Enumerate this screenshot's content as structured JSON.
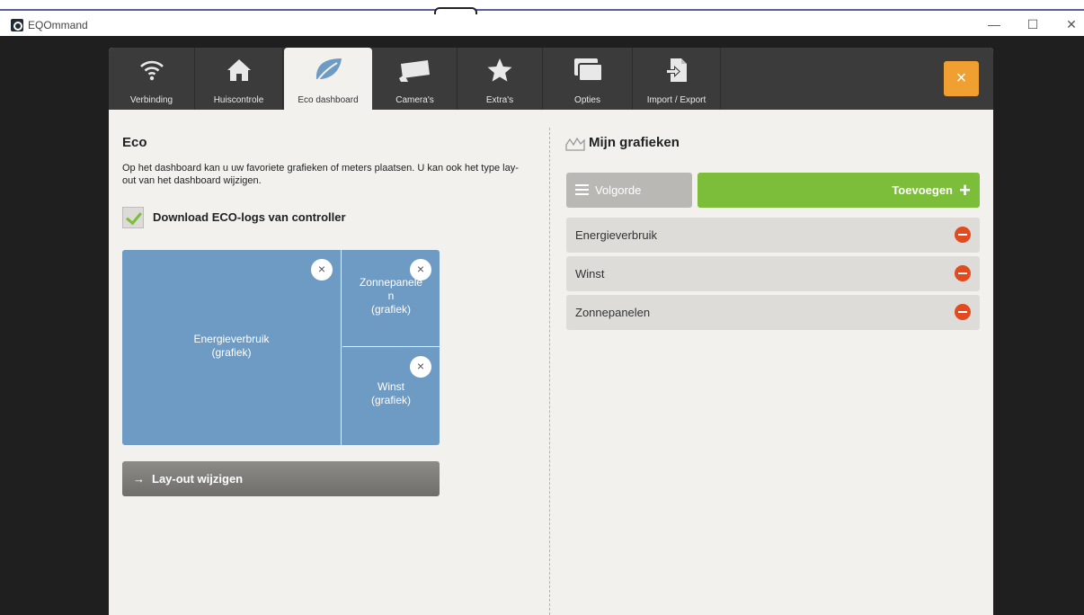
{
  "window": {
    "title": "EQOmmand",
    "minimize": "—",
    "maximize": "☐",
    "close": "✕"
  },
  "tabs": [
    {
      "label": "Verbinding",
      "icon": "wifi-icon"
    },
    {
      "label": "Huiscontrole",
      "icon": "house-icon"
    },
    {
      "label": "Eco dashboard",
      "icon": "leaf-icon",
      "active": true
    },
    {
      "label": "Camera's",
      "icon": "camera-icon"
    },
    {
      "label": "Extra's",
      "icon": "star-icon"
    },
    {
      "label": "Opties",
      "icon": "windows-icon"
    },
    {
      "label": "Import / Export",
      "icon": "import-export-icon"
    }
  ],
  "close_button": "×",
  "eco": {
    "title": "Eco",
    "description": "Op het dashboard kan u uw favoriete grafieken of meters plaatsen. U kan ook het type lay-out van het dashboard wijzigen.",
    "download_logs_label": "Download ECO-logs van controller",
    "download_logs_checked": true,
    "tiles": {
      "big": {
        "name": "Energieverbruik",
        "type": "(grafiek)"
      },
      "top": {
        "name": "Zonnepanele",
        "name_wrap": "n",
        "type": "(grafiek)"
      },
      "bottom": {
        "name": "Winst",
        "type": "(grafiek)"
      },
      "remove_symbol": "×"
    },
    "layout_button": "Lay-out wijzigen",
    "layout_arrow": "→"
  },
  "graphs": {
    "title": "Mijn grafieken",
    "order_button": "Volgorde",
    "add_button": "Toevoegen",
    "add_symbol": "+",
    "items": [
      "Energieverbruik",
      "Winst",
      "Zonnepanelen"
    ]
  },
  "colors": {
    "accent_green": "#7cbd3a",
    "tile_blue": "#6d9bc3",
    "close_orange": "#f0a030",
    "remove_red": "#e14b1f",
    "navbar": "#3b3b3b"
  }
}
